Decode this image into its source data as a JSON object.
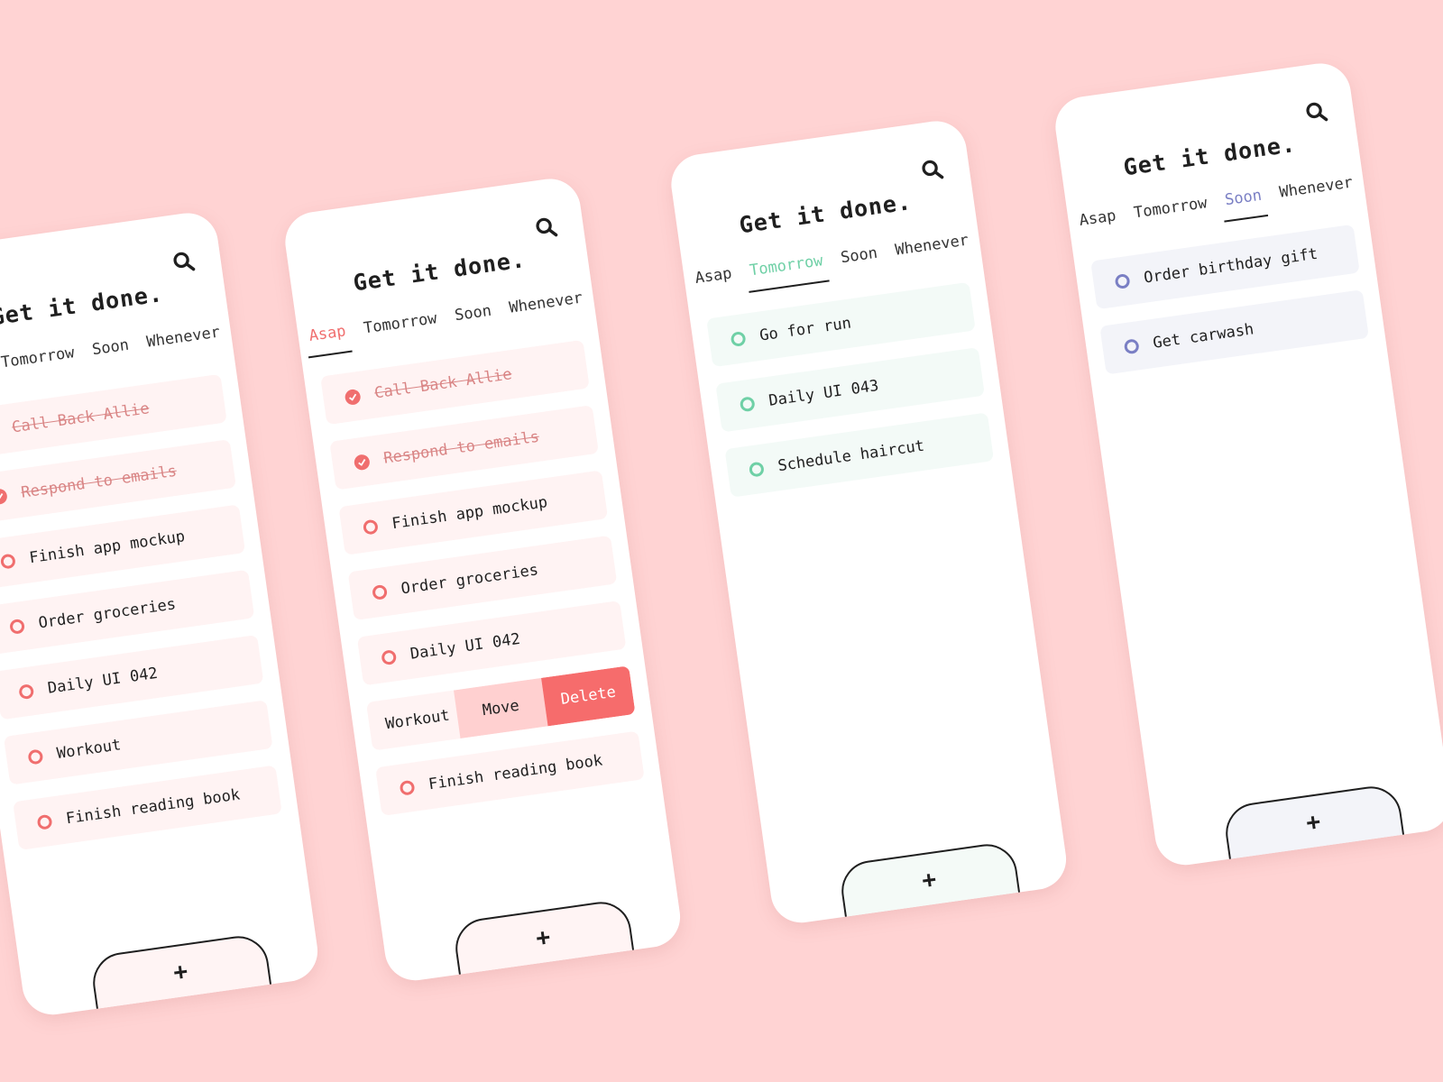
{
  "app": {
    "title": "Get it done.",
    "add_symbol": "+"
  },
  "tabs": [
    "Asap",
    "Tomorrow",
    "Soon",
    "Whenever"
  ],
  "colors": {
    "background": "#ffd3d3",
    "red": "#f06e6e",
    "green": "#6fd0a6",
    "blue": "#7a7fc4"
  },
  "screens": [
    {
      "tasks": [
        {
          "label": "Call Back Allie",
          "done": true
        },
        {
          "label": "Respond to emails",
          "done": true
        },
        {
          "label": "Finish app mockup",
          "done": false
        },
        {
          "label": "Order groceries",
          "done": false
        },
        {
          "label": "Daily UI 042",
          "done": false
        },
        {
          "label": "Workout",
          "done": false
        },
        {
          "label": "Finish reading book",
          "done": false
        }
      ]
    },
    {
      "active_tab": "Asap",
      "tasks": [
        {
          "label": "Call Back Allie",
          "done": true
        },
        {
          "label": "Respond to emails",
          "done": true
        },
        {
          "label": "Finish app mockup",
          "done": false
        },
        {
          "label": "Order groceries",
          "done": false
        },
        {
          "label": "Daily UI 042",
          "done": false
        },
        {
          "label": "Workout",
          "done": false,
          "swipe_move": "Move",
          "swipe_delete": "Delete"
        },
        {
          "label": "Finish reading book",
          "done": false
        }
      ]
    },
    {
      "active_tab": "Tomorrow",
      "tasks": [
        {
          "label": "Go for run",
          "done": false
        },
        {
          "label": "Daily UI 043",
          "done": false
        },
        {
          "label": "Schedule haircut",
          "done": false
        }
      ]
    },
    {
      "active_tab": "Soon",
      "tasks": [
        {
          "label": "Order birthday gift",
          "done": false
        },
        {
          "label": "Get carwash",
          "done": false
        }
      ]
    }
  ]
}
